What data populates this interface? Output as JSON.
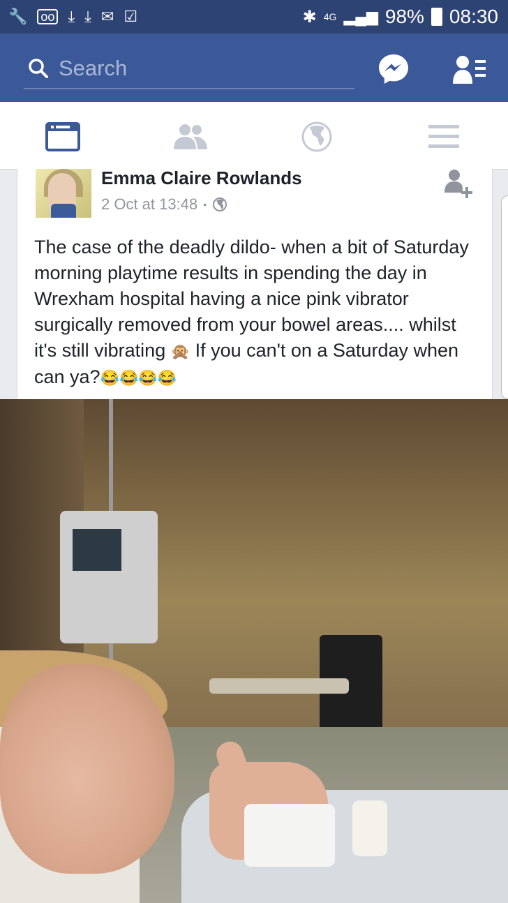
{
  "status_bar": {
    "left_icons": [
      "wrench-icon",
      "voicemail-icon",
      "download-icon",
      "download-icon",
      "mail-icon",
      "clipboard-check-icon"
    ],
    "network": "4G",
    "battery": "98%",
    "time": "08:30"
  },
  "app_bar": {
    "search_placeholder": "Search",
    "icons": [
      "search-icon",
      "messenger-icon",
      "friend-requests-icon"
    ]
  },
  "tabs": [
    {
      "name": "news-feed",
      "icon": "news-feed-icon",
      "active": true
    },
    {
      "name": "friends",
      "icon": "friends-icon",
      "active": false
    },
    {
      "name": "notifications",
      "icon": "globe-icon",
      "active": false
    },
    {
      "name": "more",
      "icon": "menu-icon",
      "active": false
    }
  ],
  "post": {
    "author": "Emma Claire Rowlands",
    "timestamp": "2 Oct at 13:48",
    "separator": "•",
    "privacy_icon": "public-globe-icon",
    "text_line1": "The case of the deadly dildo- when a bit of Saturday morning playtime results in  spending the day in Wrexham hospital having a nice pink vibrator surgically removed from your bowel areas.... whilst it's still vibrating ",
    "emoji1": "🙊",
    "text_line2": " If you can't on a Saturday when can ya?",
    "emoji2": "😂😂😂😂",
    "photo_icon": "hospital-photo"
  },
  "colors": {
    "status_bar_bg": "#2d4373",
    "app_bar_bg": "#3b5998",
    "tab_active": "#3b5998",
    "tab_inactive": "#c4c9d3"
  }
}
